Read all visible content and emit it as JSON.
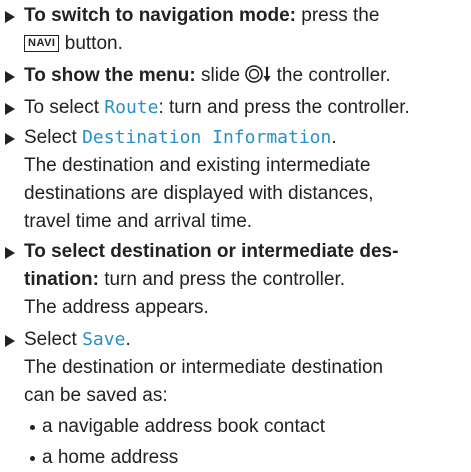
{
  "steps": [
    {
      "bold": "To switch to navigation mode:",
      "text": "press the",
      "button": "NAVI",
      "text2": "button."
    },
    {
      "bold": "To show the menu:",
      "text": "slide",
      "text2": "the controller.",
      "icon": "controller-slide-down-icon"
    },
    {
      "text": "To select",
      "ui": "Route",
      "text2": ": turn and press the controller."
    },
    {
      "text": "Select",
      "ui": "Destination Information",
      "text2": ".",
      "result": [
        "The destination and existing intermediate",
        "destinations are displayed with distances,",
        "travel time and arrival time."
      ]
    },
    {
      "bold": "To select destination or intermediate des-",
      "bold2": "tination:",
      "text": "turn and press the controller.",
      "result": "The address appears."
    },
    {
      "text": "Select",
      "ui": "Save",
      "text2": ".",
      "result": [
        "The destination or intermediate destination",
        "can be saved as:"
      ],
      "bullets": [
        "a navigable address book contact",
        "a home address"
      ]
    }
  ],
  "colors": {
    "ui_text": "#2a90c4",
    "text": "#222222"
  }
}
